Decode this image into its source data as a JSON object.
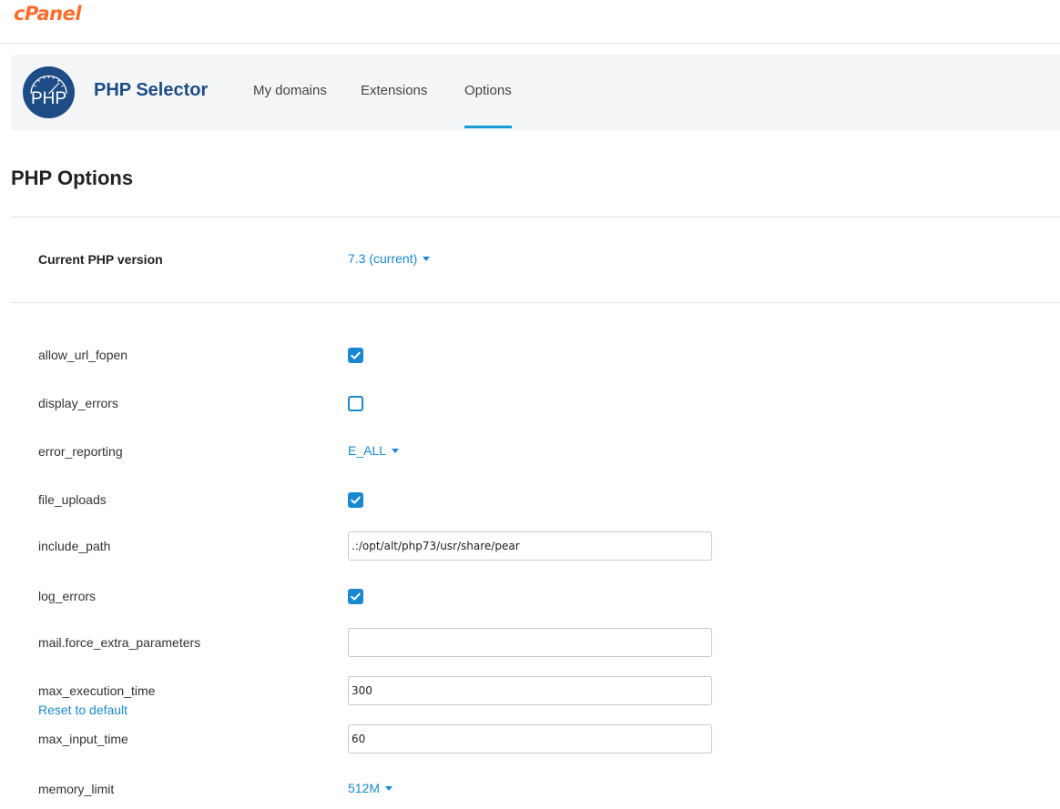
{
  "brand": {
    "logo_text": "cPanel",
    "brand_color": "#ff6c2c"
  },
  "app": {
    "badge_text": "PHP",
    "title": "PHP Selector",
    "tabs": [
      {
        "label": "My domains",
        "active": false
      },
      {
        "label": "Extensions",
        "active": false
      },
      {
        "label": "Options",
        "active": true
      }
    ],
    "accent_color": "#179bd7"
  },
  "page": {
    "title": "PHP Options",
    "current_version_label": "Current PHP version",
    "current_version_value": "7.3 (current)"
  },
  "options": {
    "allow_url_fopen": {
      "label": "allow_url_fopen",
      "checked": true
    },
    "display_errors": {
      "label": "display_errors",
      "checked": false
    },
    "error_reporting": {
      "label": "error_reporting",
      "value": "E_ALL"
    },
    "file_uploads": {
      "label": "file_uploads",
      "checked": true
    },
    "include_path": {
      "label": "include_path",
      "value": ".:/opt/alt/php73/usr/share/pear"
    },
    "log_errors": {
      "label": "log_errors",
      "checked": true
    },
    "mail_force_extra_parameters": {
      "label": "mail.force_extra_parameters",
      "value": ""
    },
    "max_execution_time": {
      "label": "max_execution_time",
      "value": "300",
      "reset_label": "Reset to default"
    },
    "max_input_time": {
      "label": "max_input_time",
      "value": "60"
    },
    "memory_limit": {
      "label": "memory_limit",
      "value": "512M"
    }
  },
  "colors": {
    "link": "#1a88d0",
    "title": "#1e4c86"
  }
}
